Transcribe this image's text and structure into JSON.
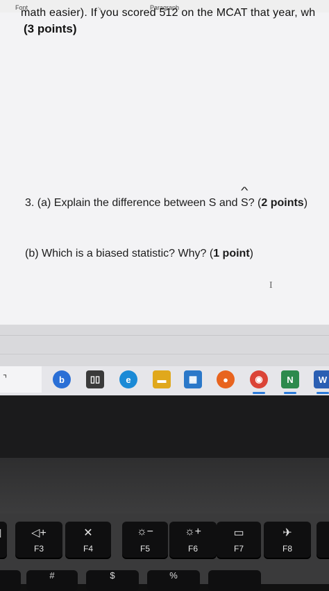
{
  "ribbon": {
    "font_label": "Font",
    "paragraph_label": "Paragraph",
    "launcher_glyph": "↘"
  },
  "document": {
    "cut_off_text": "math easier). If you scored 512 on the MCAT that year, wh",
    "points_line": "(3 points)",
    "q3a_prefix": "3. (a) Explain the difference between S and ",
    "q3a_shat": "S",
    "q3a_hat": "^",
    "q3a_mid": "? (",
    "q3a_points": "2 points",
    "q3a_end": ")",
    "q3b_prefix": "(b) Which is a biased statistic? Why? (",
    "q3b_points": "1 point",
    "q3b_end": ")",
    "text_cursor": "I"
  },
  "taskbar": {
    "arrow": "⌝",
    "icons": [
      {
        "name": "bing-icon",
        "glyph": "b",
        "color": "#2a6fd6"
      },
      {
        "name": "task-view-icon",
        "glyph": "▯▯",
        "color": "#3a3a3a"
      },
      {
        "name": "edge-icon",
        "glyph": "e",
        "color": "#1b8ad6"
      },
      {
        "name": "file-explorer-icon",
        "glyph": "▬",
        "color": "#e0a81c"
      },
      {
        "name": "store-icon",
        "glyph": "▦",
        "color": "#2b78c9"
      },
      {
        "name": "firefox-icon",
        "glyph": "●",
        "color": "#e8641f"
      },
      {
        "name": "chrome-icon",
        "glyph": "◉",
        "color": "#db4437"
      },
      {
        "name": "excel-like-icon",
        "glyph": "N",
        "color": "#2d8a4d"
      },
      {
        "name": "word-icon",
        "glyph": "W",
        "color": "#2b5fb3"
      }
    ]
  },
  "keys": [
    {
      "name": "mute-key",
      "sym": "◁",
      "label": ""
    },
    {
      "name": "volume-up-key",
      "sym": "◁+",
      "label": "F3"
    },
    {
      "name": "mic-mute-key",
      "sym": "✕",
      "label": "F4"
    },
    {
      "name": "brightness-down-key",
      "sym": "☼−",
      "label": "F5"
    },
    {
      "name": "brightness-up-key",
      "sym": "☼+",
      "label": "F6"
    },
    {
      "name": "display-key",
      "sym": "▭",
      "label": "F7"
    },
    {
      "name": "airplane-key",
      "sym": "✈",
      "label": "F8"
    },
    {
      "name": "f9-key",
      "sym": "",
      "label": ""
    }
  ],
  "keys_row2": [
    {
      "name": "number-key",
      "label": ""
    },
    {
      "name": "hash-key",
      "label": "#"
    },
    {
      "name": "dollar-key",
      "label": "$"
    },
    {
      "name": "percent-key",
      "label": "%"
    },
    {
      "name": "caret-key",
      "label": ""
    }
  ]
}
